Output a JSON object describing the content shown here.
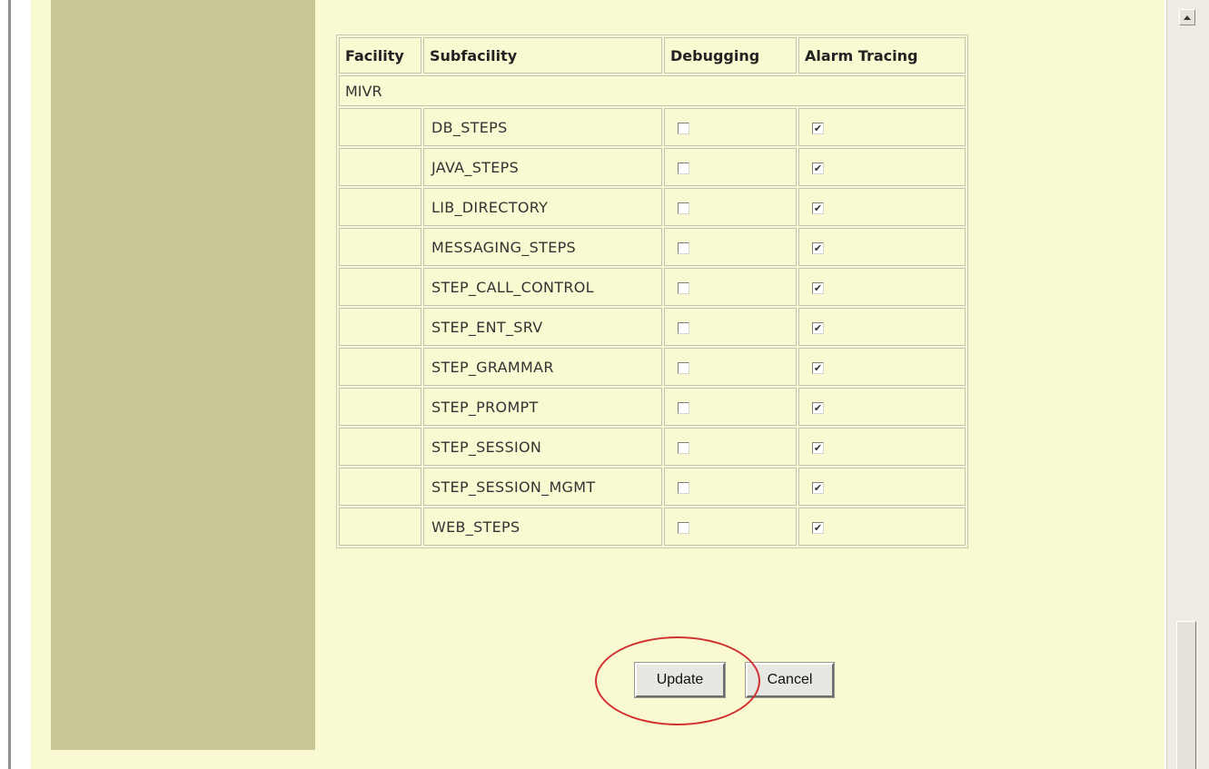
{
  "table": {
    "headers": {
      "facility": "Facility",
      "subfacility": "Subfacility",
      "debugging": "Debugging",
      "alarm_tracing": "Alarm Tracing"
    },
    "facility_name": "MIVR",
    "rows": [
      {
        "subfacility": "DB_STEPS",
        "debugging": false,
        "alarm_tracing": true
      },
      {
        "subfacility": "JAVA_STEPS",
        "debugging": false,
        "alarm_tracing": true
      },
      {
        "subfacility": "LIB_DIRECTORY",
        "debugging": false,
        "alarm_tracing": true
      },
      {
        "subfacility": "MESSAGING_STEPS",
        "debugging": false,
        "alarm_tracing": true
      },
      {
        "subfacility": "STEP_CALL_CONTROL",
        "debugging": false,
        "alarm_tracing": true
      },
      {
        "subfacility": "STEP_ENT_SRV",
        "debugging": false,
        "alarm_tracing": true
      },
      {
        "subfacility": "STEP_GRAMMAR",
        "debugging": false,
        "alarm_tracing": true
      },
      {
        "subfacility": "STEP_PROMPT",
        "debugging": false,
        "alarm_tracing": true
      },
      {
        "subfacility": "STEP_SESSION",
        "debugging": false,
        "alarm_tracing": true
      },
      {
        "subfacility": "STEP_SESSION_MGMT",
        "debugging": false,
        "alarm_tracing": true
      },
      {
        "subfacility": "WEB_STEPS",
        "debugging": false,
        "alarm_tracing": true
      }
    ]
  },
  "buttons": {
    "update_label": "Update",
    "cancel_label": "Cancel"
  },
  "colors": {
    "page_background": "#fafad2",
    "sidebar": "#c8c695",
    "annotation_circle": "#d03030"
  }
}
